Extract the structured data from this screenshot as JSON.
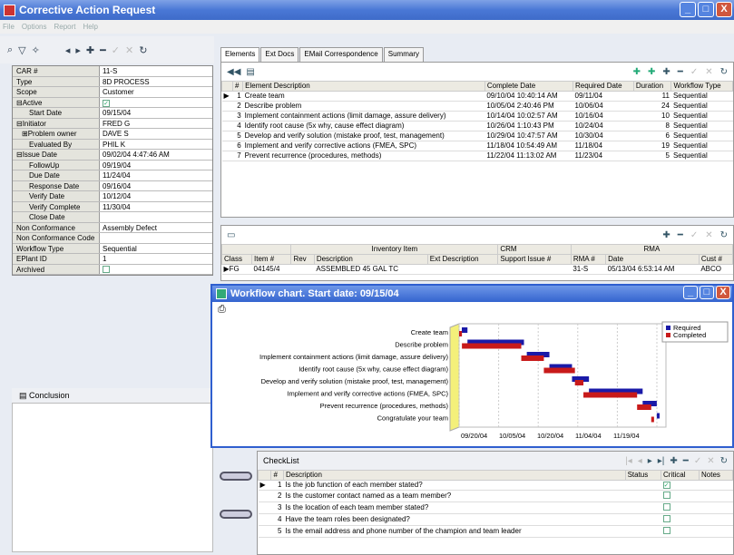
{
  "window": {
    "title": "Corrective Action Request",
    "btn_min": "_",
    "btn_max": "□",
    "btn_close": "X"
  },
  "menu": [
    "File",
    "Options",
    "Report",
    "Help"
  ],
  "left_grid": [
    {
      "k": "CAR #",
      "v": "11-S",
      "indent": 0
    },
    {
      "k": "Type",
      "v": "8D PROCESS",
      "indent": 0
    },
    {
      "k": "Scope",
      "v": "Customer",
      "indent": 0
    },
    {
      "k": "⊟Active",
      "v": "✓",
      "indent": 0,
      "check": true
    },
    {
      "k": "Start Date",
      "v": "09/15/04",
      "indent": 2
    },
    {
      "k": "⊟Initiator",
      "v": "FRED G",
      "indent": 0
    },
    {
      "k": "⊞Problem owner",
      "v": "DAVE S",
      "indent": 1
    },
    {
      "k": "Evaluated By",
      "v": "PHIL K",
      "indent": 2
    },
    {
      "k": "⊟Issue Date",
      "v": "09/02/04 4:47:46 AM",
      "indent": 0
    },
    {
      "k": "FollowUp",
      "v": "09/19/04",
      "indent": 2
    },
    {
      "k": "Due Date",
      "v": "11/24/04",
      "indent": 2
    },
    {
      "k": "Response Date",
      "v": "09/16/04",
      "indent": 2
    },
    {
      "k": "Verify Date",
      "v": "10/12/04",
      "indent": 2
    },
    {
      "k": "Verify Complete",
      "v": "11/30/04",
      "indent": 2
    },
    {
      "k": "Close Date",
      "v": "",
      "indent": 2
    },
    {
      "k": "Non Conformance",
      "v": "Assembly Defect",
      "indent": 0
    },
    {
      "k": "Non Conformance Code",
      "v": "",
      "indent": 0
    },
    {
      "k": "Workflow Type",
      "v": "Sequential",
      "indent": 0
    },
    {
      "k": "EPlant ID",
      "v": "1",
      "indent": 0
    },
    {
      "k": "Archived",
      "v": "",
      "indent": 0,
      "check": true
    }
  ],
  "conclusion_label": "Conclusion",
  "tabs": [
    "Elements",
    "Ext Docs",
    "EMail Correspondence",
    "Summary"
  ],
  "elements": {
    "headers": [
      "#",
      "Element Description",
      "Complete Date",
      "Required Date",
      "Duration",
      "Workflow Type"
    ],
    "rows": [
      [
        "1",
        "Create team",
        "09/10/04 10:40:14 AM",
        "09/11/04",
        "11",
        "Sequential"
      ],
      [
        "2",
        "Describe problem",
        "10/05/04 2:40:46 PM",
        "10/06/04",
        "24",
        "Sequential"
      ],
      [
        "3",
        "Implement containment actions (limit damage, assure delivery)",
        "10/14/04 10:02:57 AM",
        "10/16/04",
        "10",
        "Sequential"
      ],
      [
        "4",
        "Identify root cause (5x why, cause effect diagram)",
        "10/26/04 1:10:43 PM",
        "10/24/04",
        "8",
        "Sequential"
      ],
      [
        "5",
        "Develop and verify solution (mistake proof, test, management)",
        "10/29/04 10:47:57 AM",
        "10/30/04",
        "6",
        "Sequential"
      ],
      [
        "6",
        "Implement and verify corrective actions (FMEA, SPC)",
        "11/18/04 10:54:49 AM",
        "11/18/04",
        "19",
        "Sequential"
      ],
      [
        "7",
        "Prevent recurrence (procedures, methods)",
        "11/22/04 11:13:02 AM",
        "11/23/04",
        "5",
        "Sequential"
      ]
    ]
  },
  "inventory": {
    "group_inventory": "Inventory Item",
    "group_crm": "CRM",
    "group_rma": "RMA",
    "headers": [
      "Class",
      "Item #",
      "Rev",
      "Description",
      "Ext Description",
      "Support Issue #",
      "RMA #",
      "Date",
      "Cust #"
    ],
    "row": [
      "FG",
      "04145/4",
      "",
      "ASSEMBLED 45 GAL TC",
      "",
      "",
      "31-S",
      "05/13/04 6:53:14 AM",
      "ABCO"
    ]
  },
  "workflow": {
    "title": "Workflow chart. Start date: 09/15/04",
    "legend_required": "Required",
    "legend_completed": "Completed",
    "color_required": "#1a1aa8",
    "color_completed": "#c81a1a"
  },
  "chart_data": {
    "type": "bar",
    "orientation": "horizontal-gantt",
    "categories": [
      "Create team",
      "Describe problem",
      "Implement containment actions (limit damage, assure delivery)",
      "Identify root cause (5x why, cause effect diagram)",
      "Develop and verify solution (mistake proof, test, management)",
      "Implement and verify corrective actions (FMEA, SPC)",
      "Prevent recurrence (procedures, methods)",
      "Congratulate your team"
    ],
    "x_ticks": [
      "09/20/04",
      "10/05/04",
      "10/20/04",
      "11/04/04",
      "11/19/04"
    ],
    "series": [
      {
        "name": "Required",
        "start": [
          0,
          2,
          23,
          31,
          39,
          45,
          64,
          69
        ],
        "end": [
          2,
          22,
          31,
          39,
          45,
          64,
          69,
          70
        ]
      },
      {
        "name": "Completed",
        "start": [
          0,
          1,
          22,
          30,
          41,
          44,
          63,
          68
        ],
        "end": [
          1,
          22,
          30,
          41,
          44,
          63,
          68,
          69
        ]
      }
    ],
    "legend": "top-right",
    "grid": true
  },
  "checklist": {
    "title": "CheckList",
    "headers": [
      "#",
      "Description",
      "Status",
      "Critical",
      "Notes"
    ],
    "rows": [
      [
        "1",
        "Is the job function of each member stated?",
        "",
        "✓",
        ""
      ],
      [
        "2",
        "Is the customer contact named as a team member?",
        "",
        "",
        ""
      ],
      [
        "3",
        "Is the location of each team member stated?",
        "",
        "",
        ""
      ],
      [
        "4",
        "Have the team roles been designated?",
        "",
        "",
        ""
      ],
      [
        "5",
        "Is the email address and phone number of the champion and team leader",
        "",
        "",
        ""
      ]
    ]
  }
}
